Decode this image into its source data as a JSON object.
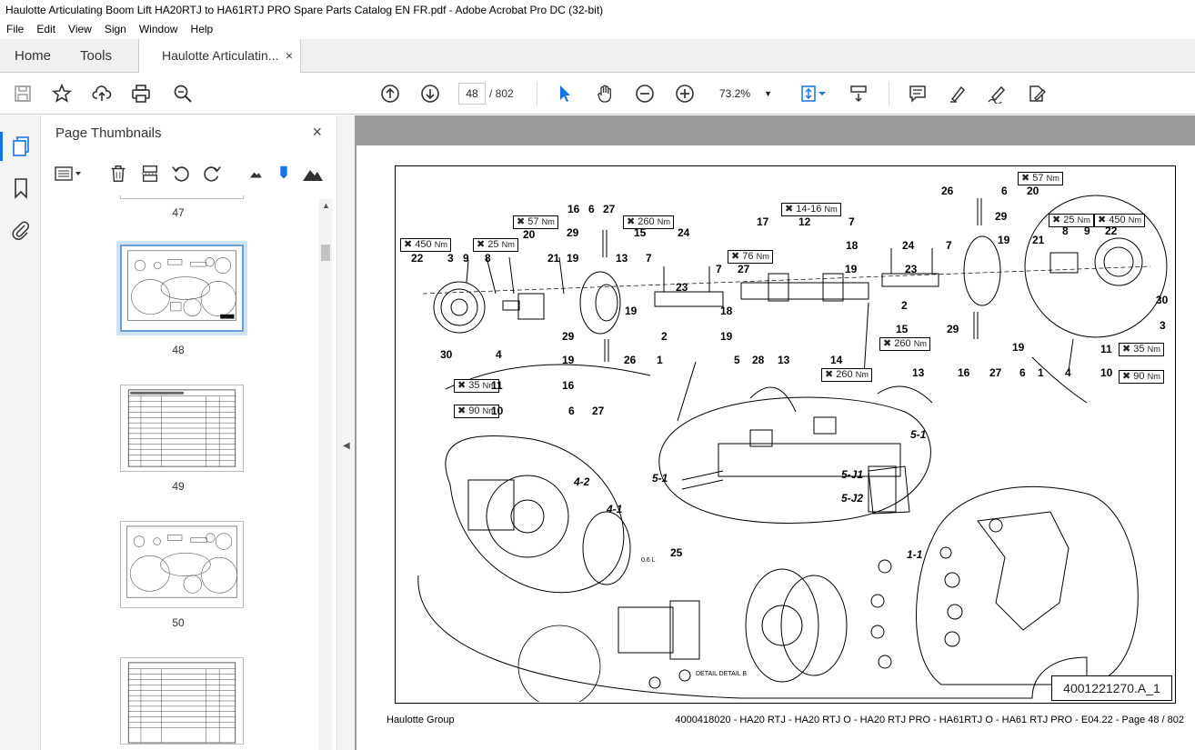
{
  "window": {
    "title": "Haulotte Articulating Boom Lift HA20RTJ to HA61RTJ PRO Spare Parts Catalog EN FR.pdf - Adobe Acrobat Pro DC (32-bit)"
  },
  "menu": [
    "File",
    "Edit",
    "View",
    "Sign",
    "Window",
    "Help"
  ],
  "tabs": {
    "home": "Home",
    "tools": "Tools",
    "doc": "Haulotte Articulatin...",
    "close": "×"
  },
  "toolbar": {
    "current_page": "48",
    "page_total": "/ 802",
    "zoom": "73.2%"
  },
  "panel": {
    "title": "Page Thumbnails",
    "close": "×",
    "thumbnails": [
      {
        "label": "47"
      },
      {
        "label": "48"
      },
      {
        "label": "49"
      },
      {
        "label": "50"
      }
    ]
  },
  "document": {
    "footer_left": "Haulotte Group",
    "footer_right": "4000418020 - HA20 RTJ - HA20 RTJ O - HA20 RTJ PRO - HA61RTJ O - HA61 RTJ PRO - E04.22 - Page 48 / 802",
    "drawing_ref": "4001221270.A_1",
    "part_labels": {
      "p22a": "22",
      "p3a": "3",
      "p9a": "9",
      "p8a": "8",
      "p20a": "20",
      "p21a": "21",
      "p16a": "16",
      "p6a": "6",
      "p27a": "27",
      "p29a": "29",
      "p19a": "19",
      "p15a": "15",
      "p13a": "13",
      "p7a": "7",
      "p24a": "24",
      "p7b": "7",
      "p27b": "27",
      "p17": "17",
      "p12": "12",
      "p7c": "7",
      "p18a": "18",
      "p24b": "24",
      "p7d": "7",
      "p26a": "26",
      "p6b": "6",
      "p20b": "20",
      "p29b": "29",
      "p19b": "19",
      "p21b": "21",
      "p8b": "8",
      "p9b": "9",
      "p22b": "22",
      "p30a": "30",
      "p4a": "4",
      "p11a": "11",
      "p10a": "10",
      "p29c": "29",
      "p19c": "19",
      "p16b": "16",
      "p6c": "6",
      "p27c": "27",
      "p26b": "26",
      "p1a": "1",
      "p2a": "2",
      "p18b": "18",
      "p19d": "19",
      "p23a": "23",
      "p19e": "19",
      "p5": "5",
      "p28": "28",
      "p13b": "13",
      "p14": "14",
      "p19f": "19",
      "p23b": "23",
      "p2b": "2",
      "p15b": "15",
      "p13c": "13",
      "p29d": "29",
      "p16c": "16",
      "p27d": "27",
      "p6d": "6",
      "p1b": "1",
      "p4b": "4",
      "p19g": "19",
      "p11b": "11",
      "p10b": "10",
      "p30b": "30",
      "p3b": "3",
      "p25": "25",
      "d42": "4-2",
      "d41": "4-1",
      "d51a": "5-1",
      "d51b": "5-1",
      "dj1": "5-J1",
      "dj2": "5-J2",
      "d11": "1-1",
      "detail": "DETAIL DETAIL B",
      "oil": "0.6 L"
    },
    "torques": {
      "t450a": "450",
      "t25a": "25",
      "t57a": "57",
      "t260a": "260",
      "t76": "76",
      "t1416": "14-16",
      "t57b": "57",
      "t25b": "25",
      "t450b": "450",
      "t35a": "35",
      "t90a": "90",
      "t260b": "260",
      "t260c": "260",
      "t35b": "35",
      "t90b": "90"
    }
  }
}
